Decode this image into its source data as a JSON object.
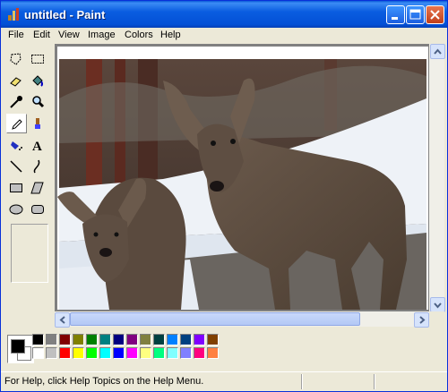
{
  "window": {
    "title": "untitled - Paint",
    "app_icon": "paint-brush-icon",
    "controls": {
      "minimize": "minimize-icon",
      "maximize": "maximize-icon",
      "close": "close-icon"
    }
  },
  "menu": [
    "File",
    "Edit",
    "View",
    "Image",
    "Colors",
    "Help"
  ],
  "tools": [
    {
      "name": "free-form-select-tool",
      "icon": "free-form-select-icon"
    },
    {
      "name": "select-tool",
      "icon": "rect-select-icon"
    },
    {
      "name": "eraser-tool",
      "icon": "eraser-icon"
    },
    {
      "name": "fill-tool",
      "icon": "paint-bucket-icon"
    },
    {
      "name": "pick-color-tool",
      "icon": "eyedropper-icon"
    },
    {
      "name": "magnifier-tool",
      "icon": "magnifier-icon"
    },
    {
      "name": "pencil-tool",
      "icon": "pencil-icon",
      "active": true
    },
    {
      "name": "brush-tool",
      "icon": "brush-icon"
    },
    {
      "name": "airbrush-tool",
      "icon": "airbrush-icon"
    },
    {
      "name": "text-tool",
      "icon": "text-icon"
    },
    {
      "name": "line-tool",
      "icon": "line-icon"
    },
    {
      "name": "curve-tool",
      "icon": "curve-icon"
    },
    {
      "name": "rectangle-tool",
      "icon": "rectangle-icon"
    },
    {
      "name": "polygon-tool",
      "icon": "polygon-icon"
    },
    {
      "name": "ellipse-tool",
      "icon": "ellipse-icon"
    },
    {
      "name": "rounded-rect-tool",
      "icon": "rounded-rect-icon"
    }
  ],
  "canvas": {
    "image": "two-deer-in-snow-photo"
  },
  "colors": {
    "foreground": "#000000",
    "background": "#ffffff",
    "palette_row1": [
      "#000000",
      "#808080",
      "#800000",
      "#808000",
      "#008000",
      "#008080",
      "#000080",
      "#800080",
      "#808040",
      "#004040",
      "#0080ff",
      "#004080",
      "#8000ff",
      "#804000"
    ],
    "palette_row2": [
      "#ffffff",
      "#c0c0c0",
      "#ff0000",
      "#ffff00",
      "#00ff00",
      "#00ffff",
      "#0000ff",
      "#ff00ff",
      "#ffff80",
      "#00ff80",
      "#80ffff",
      "#8080ff",
      "#ff0080",
      "#ff8040"
    ]
  },
  "status": {
    "text": "For Help, click Help Topics on the Help Menu."
  }
}
